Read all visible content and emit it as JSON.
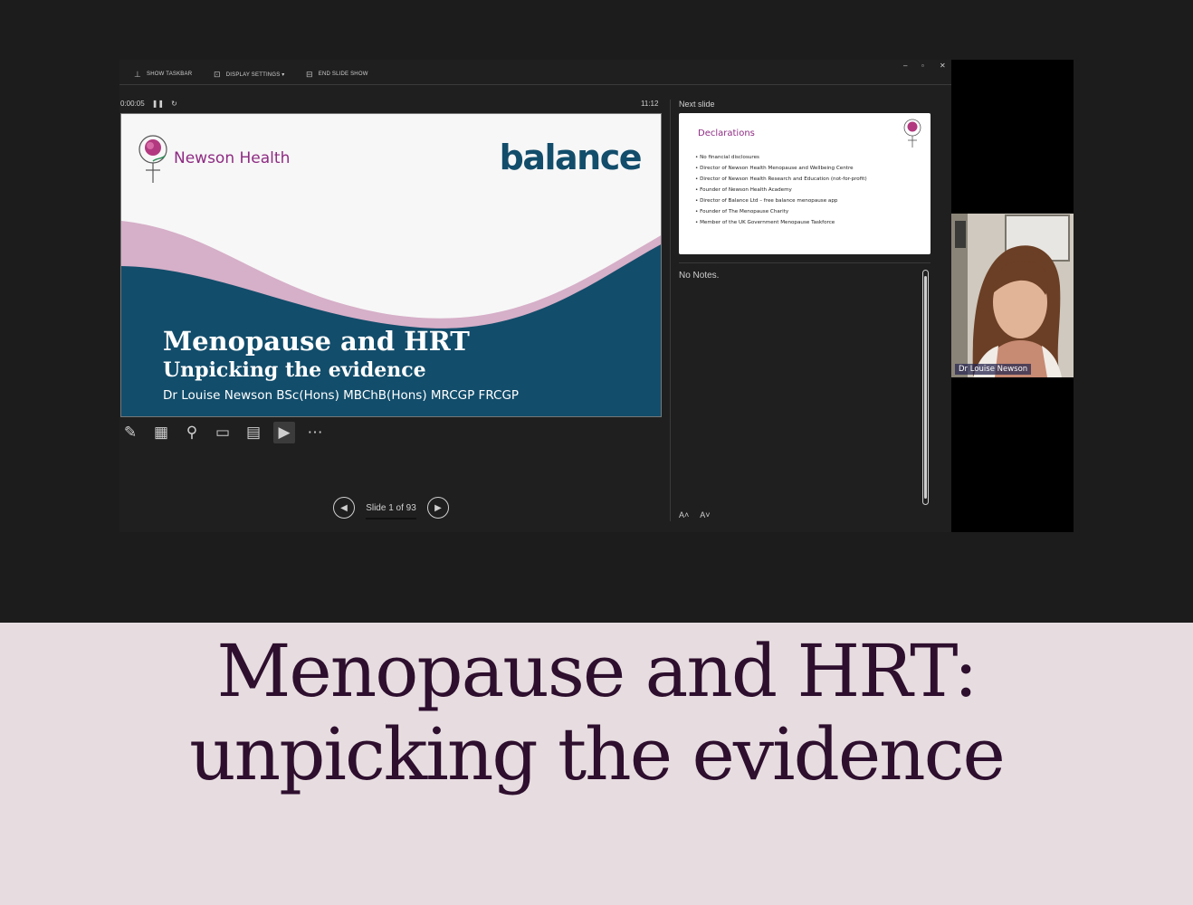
{
  "toolbar": {
    "show_taskbar": "SHOW TASKBAR",
    "display_settings": "DISPLAY SETTINGS ▾",
    "end_slide_show": "END SLIDE SHOW"
  },
  "timer": {
    "elapsed": "0:00:05",
    "clock": "11:12"
  },
  "current_slide": {
    "brand": "Newson Health",
    "logo_text": "balance",
    "title": "Menopause and HRT",
    "subtitle": "Unpicking the evidence",
    "author": "Dr Louise Newson BSc(Hons) MBChB(Hons) MRCGP FRCGP"
  },
  "next_slide": {
    "label": "Next slide",
    "title": "Declarations",
    "items": [
      "No financial disclosures",
      "Director of Newson Health Menopause and Wellbeing Centre",
      "Director of Newson Health Research and Education (not-for-profit)",
      "Founder of Newson Health Academy",
      "Director of Balance Ltd – free balance menopause app",
      "Founder of The Menopause Charity",
      "Member of the UK Government Menopause Taskforce"
    ]
  },
  "notes": {
    "text": "No Notes."
  },
  "navigation": {
    "slide_counter": "Slide 1 of 93"
  },
  "camera": {
    "name": "Dr Louise Newson"
  },
  "caption": {
    "line1": "Menopause and HRT:",
    "line2": "unpicking the evidence"
  },
  "colors": {
    "brand_purple": "#8e2b83",
    "teal": "#124d6b",
    "pink_wave": "#d6afc8",
    "caption_bg": "#e7dde0",
    "caption_text": "#2e0f2e"
  }
}
